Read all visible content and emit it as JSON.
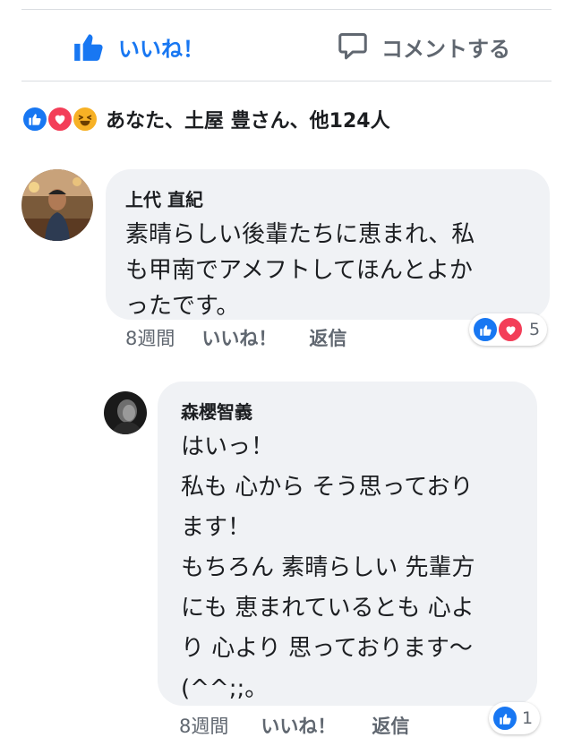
{
  "actions": {
    "like_label": "いいね！",
    "comment_label": "コメントする"
  },
  "reactions_summary": "あなた、土屋 豊さん、他124人",
  "comments": [
    {
      "author": "上代 直紀",
      "lines": [
        "素晴らしい後輩たちに恵まれ、私",
        "も甲南でアメフトしてほんとよか",
        "ったです。"
      ],
      "time": "8週間",
      "like_label": "いいね！",
      "reply_label": "返信",
      "reaction_count": "5"
    },
    {
      "author": "森櫻智義",
      "lines": [
        "はいっ！",
        "私も 心から そう思っており",
        "ます！",
        "もちろん 素晴らしい 先輩方",
        "にも 恵まれているとも 心よ",
        "り 心より 思っております〜",
        "(^^;;。"
      ],
      "time": "8週間",
      "like_label": "いいね！",
      "reply_label": "返信",
      "reaction_count": "1"
    }
  ],
  "colors": {
    "accent": "#1877f2",
    "love": "#f33e58",
    "haha": "#f7b125",
    "bubble": "#f0f2f5",
    "meta": "#606770"
  }
}
